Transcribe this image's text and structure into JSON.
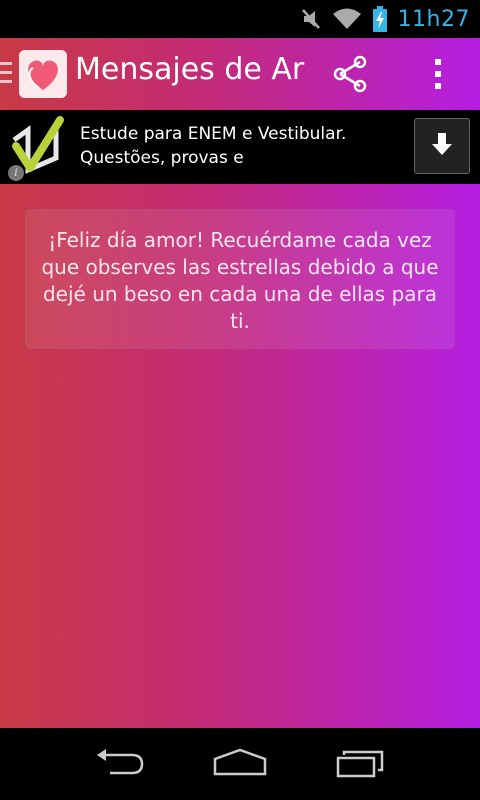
{
  "status_bar": {
    "time": "11h27",
    "icons": [
      "mute-icon",
      "wifi-icon",
      "battery-charging-icon"
    ],
    "clock_color": "#33b5e5"
  },
  "app": {
    "title": "Mensajes de Ar",
    "icon": "heart-app-icon",
    "actions": [
      "share-icon",
      "overflow-menu-icon"
    ],
    "gradient": [
      "#c83a45",
      "#c32a7a",
      "#b51ee2"
    ]
  },
  "ad": {
    "text": "Estude para ENEM e Vestibular. Questões, provas e",
    "logo": "checkmark-logo",
    "info_glyph": "i",
    "action_icon": "download-icon"
  },
  "message": {
    "text": "¡Feliz día amor! Recuérdame cada vez que observes las estrellas debido a que dejé un beso en cada una de ellas para ti."
  },
  "nav_bar": {
    "buttons": [
      "back-icon",
      "home-icon",
      "recent-apps-icon"
    ]
  }
}
